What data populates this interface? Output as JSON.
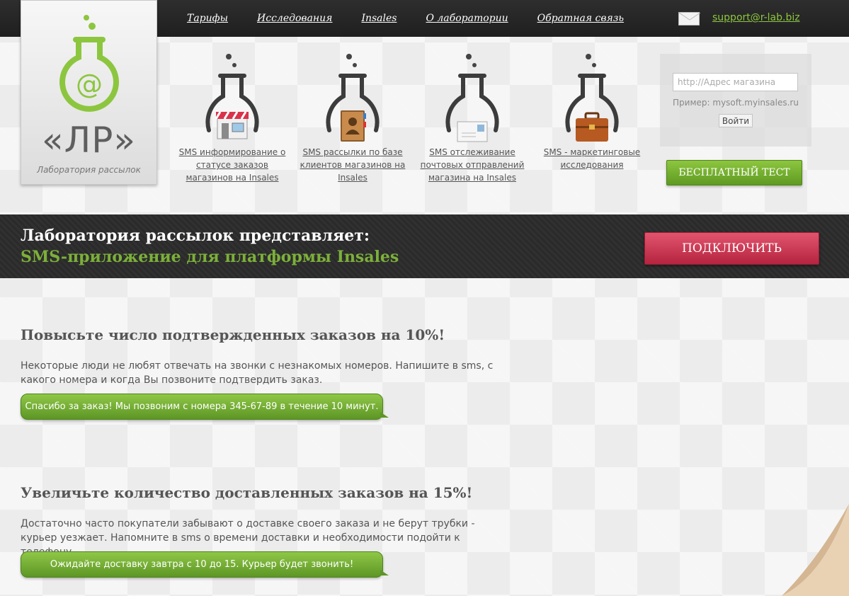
{
  "nav": {
    "links": [
      "Тарифы",
      "Исследования",
      "Insales",
      "О лаборатории",
      "Обратная связь"
    ],
    "support_email": "support@r-lab.biz"
  },
  "logo": {
    "letters": "«ЛР»",
    "subtitle": "Лаборатория рассылок"
  },
  "products": [
    {
      "label": "SMS информирование о статусе заказов магазинов на Insales",
      "icon": "shop-icon"
    },
    {
      "label": "SMS рассылки по базе клиентов магазинов на Insales",
      "icon": "address-book-icon"
    },
    {
      "label": "SMS отслеживание почтовых отправлений магазина на Insales",
      "icon": "envelope-icon"
    },
    {
      "label": "SMS - маркетинговые исследования",
      "icon": "briefcase-icon"
    }
  ],
  "store_form": {
    "placeholder": "http://Адрес магазина",
    "example": "Пример: mysoft.myinsales.ru",
    "submit": "Войти"
  },
  "free_test_label": "БЕСПЛАТНЫЙ ТЕСТ",
  "banner": {
    "title": "Лаборатория рассылок представляет:",
    "subtitle": "SMS-приложение для платформы Insales",
    "connect_label": "ПОДКЛЮЧИТЬ"
  },
  "features": [
    {
      "title": "Повысьте число подтвержденных заказов на 10%!",
      "text": "Некоторые люди не любят отвечать на звонки с незнакомых номеров. Напишите в sms, с какого номера и когда Вы позвоните подтвердить заказ.",
      "bubble": "Спасибо за заказ! Мы позвоним с номера 345-67-89 в течение 10 минут."
    },
    {
      "title": "Увеличьте количество доставленных заказов на 15%!",
      "text": "Достаточно часто покупатели забывают о доставке своего заказа и не берут трубки - курьер уезжает. Напомните в sms о времени доставки и необходимости подойти к телефону.",
      "bubble": "Ожидайте доставку завтра с 10 до 15. Курьер будет звонить!"
    }
  ],
  "colors": {
    "accent_green": "#8cc63f",
    "accent_red": "#c8304b",
    "dark_bar": "#2a2a2a"
  }
}
